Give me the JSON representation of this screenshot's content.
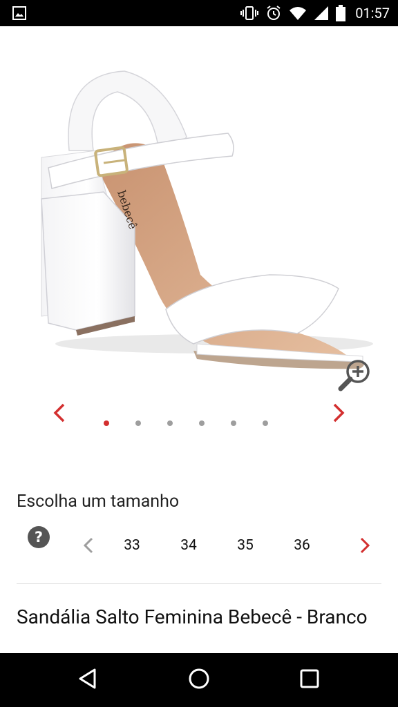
{
  "status_bar": {
    "time": "01:57",
    "icons": [
      "gallery-icon",
      "vibrate-icon",
      "alarm-icon",
      "wifi-icon",
      "signal-icon",
      "battery-icon"
    ]
  },
  "product": {
    "image_description_icon": "sandal-image",
    "gallery_total": 6,
    "gallery_active_index": 0,
    "title": "Sandália Salto Feminina Bebecê - Branco"
  },
  "size_selector": {
    "title": "Escolha um tamanho",
    "sizes": [
      "33",
      "34",
      "35",
      "36"
    ]
  },
  "colors": {
    "accent": "#d32f2f",
    "dot_inactive": "#9e9e9e",
    "text": "#222222"
  }
}
